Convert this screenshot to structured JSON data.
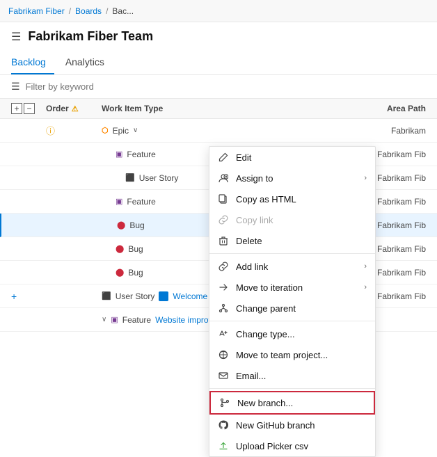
{
  "breadcrumb": {
    "items": [
      "Fabrikam Fiber",
      "Boards",
      "Bac..."
    ],
    "separator": "/"
  },
  "header": {
    "title": "Fabrikam Fiber Team",
    "hamburger": "≡"
  },
  "tabs": [
    {
      "label": "Backlog",
      "active": true
    },
    {
      "label": "Analytics",
      "active": false
    }
  ],
  "filter": {
    "placeholder": "Filter by keyword"
  },
  "table": {
    "headers": {
      "order": "Order",
      "work_item_type": "Work Item Type",
      "area_path": "Area Path"
    },
    "rows": [
      {
        "type": "Epic",
        "has_chevron": true,
        "area": "Fabrikam",
        "indent": 0,
        "highlighted": false
      },
      {
        "type": "Feature",
        "area": "Fabrikam Fib",
        "indent": 1,
        "highlighted": false
      },
      {
        "type": "User Story",
        "area": "Fabrikam Fib",
        "indent": 2,
        "highlighted": false
      },
      {
        "type": "Feature",
        "area": "Fabrikam Fib",
        "indent": 1,
        "highlighted": false
      },
      {
        "type": "Bug",
        "area": "Fabrikam Fib",
        "indent": 1,
        "highlighted": true
      },
      {
        "type": "Bug",
        "area": "Fabrikam Fib",
        "indent": 1,
        "highlighted": false
      },
      {
        "type": "Bug",
        "area": "Fabrikam Fib",
        "indent": 1,
        "highlighted": false
      },
      {
        "type": "User Story",
        "title": "Welcome back page im...",
        "area": "Fabrikam Fib",
        "indent": 0,
        "highlighted": false,
        "has_plus": true,
        "has_more": true
      },
      {
        "type": "Feature",
        "title": "Website improvements",
        "has_chevron": true,
        "area": "",
        "indent": 0,
        "highlighted": false
      }
    ]
  },
  "context_menu": {
    "items": [
      {
        "label": "Edit",
        "icon": "edit-icon",
        "divider_after": false
      },
      {
        "label": "Assign to",
        "icon": "assign-icon",
        "has_arrow": true,
        "divider_after": false
      },
      {
        "label": "Copy as HTML",
        "icon": "copy-icon",
        "divider_after": false
      },
      {
        "label": "Copy link",
        "icon": "link-icon",
        "disabled": true,
        "divider_after": false
      },
      {
        "label": "Delete",
        "icon": "delete-icon",
        "divider_after": true
      },
      {
        "label": "Add link",
        "icon": "add-link-icon",
        "has_arrow": true,
        "divider_after": false
      },
      {
        "label": "Move to iteration",
        "icon": "move-iter-icon",
        "has_arrow": true,
        "divider_after": false
      },
      {
        "label": "Change parent",
        "icon": "change-parent-icon",
        "divider_after": true
      },
      {
        "label": "Change type...",
        "icon": "change-type-icon",
        "divider_after": false
      },
      {
        "label": "Move to team project...",
        "icon": "move-project-icon",
        "divider_after": false
      },
      {
        "label": "Email...",
        "icon": "email-icon",
        "divider_after": true
      },
      {
        "label": "New branch...",
        "icon": "new-branch-icon",
        "highlighted": true,
        "divider_after": false
      },
      {
        "label": "New GitHub branch",
        "icon": "github-icon",
        "divider_after": false
      },
      {
        "label": "Upload Picker csv",
        "icon": "upload-icon",
        "divider_after": false
      }
    ]
  }
}
